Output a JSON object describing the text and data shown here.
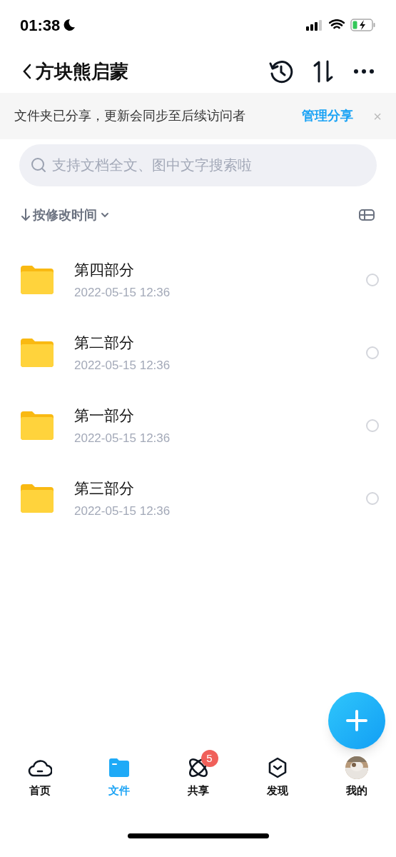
{
  "status_bar": {
    "time": "01:38"
  },
  "header": {
    "title": "方块熊启蒙"
  },
  "share_banner": {
    "message": "文件夹已分享，更新会同步至后续访问者",
    "link": "管理分享",
    "close": "×"
  },
  "search": {
    "placeholder": "支持文档全文、图中文字搜索啦"
  },
  "sort": {
    "label": "按修改时间"
  },
  "files": [
    {
      "name": "第四部分",
      "date": "2022-05-15 12:36",
      "selected": false
    },
    {
      "name": "第二部分",
      "date": "2022-05-15 12:36",
      "selected": false
    },
    {
      "name": "第一部分",
      "date": "2022-05-15 12:36",
      "selected": false
    },
    {
      "name": "第三部分",
      "date": "2022-05-15 12:36",
      "selected": false
    }
  ],
  "tabs": [
    {
      "kind": "home",
      "label": "首页",
      "selected": false
    },
    {
      "kind": "files",
      "label": "文件",
      "selected": true
    },
    {
      "kind": "share",
      "label": "共享",
      "selected": false,
      "badge": "5"
    },
    {
      "kind": "discover",
      "label": "发现",
      "selected": false
    },
    {
      "kind": "me",
      "label": "我的",
      "selected": false
    }
  ]
}
